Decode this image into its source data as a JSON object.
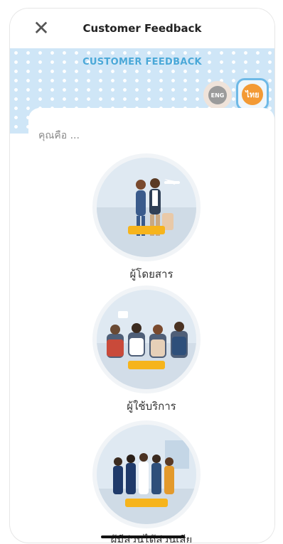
{
  "header": {
    "title": "Customer Feedback"
  },
  "banner": {
    "title": "CUSTOMER FEEDBACK"
  },
  "language": {
    "eng_label": "ENG",
    "thai_label": "ไทย"
  },
  "question": "คุณคือ ...",
  "options": [
    {
      "label": "ผู้โดยสาร"
    },
    {
      "label": "ผู้ใช้บริการ"
    },
    {
      "label": "ผู้มีส่วนได้ส่วนเสีย"
    }
  ],
  "colors": {
    "accent": "#4aa8d8",
    "banner_bg": "#cfe6f7",
    "thai_active": "#f39a35",
    "tag": "#f6b41c"
  }
}
